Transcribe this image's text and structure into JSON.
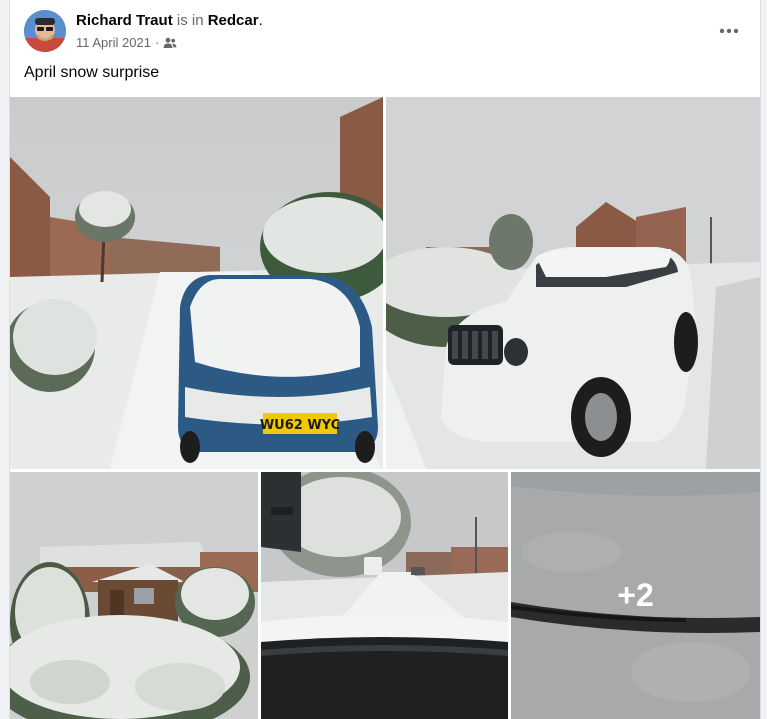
{
  "post": {
    "author": "Richard Traut",
    "location_connector": "is in",
    "location": "Redcar",
    "location_suffix": ".",
    "date": "11 April 2021",
    "date_separator": "·",
    "audience_icon": "friends-icon",
    "more_icon": "more-options-icon",
    "caption": "April snow surprise"
  },
  "photos": {
    "more_count_label": "+2",
    "items": [
      {
        "subject": "snow-covered blue hatchback",
        "plate": "WU62 WYC"
      },
      {
        "subject": "snow-covered white jeep"
      },
      {
        "subject": "snowy garden with shed"
      },
      {
        "subject": "snowy street through windscreen"
      },
      {
        "subject": "snow on windscreen wiper"
      }
    ]
  },
  "colors": {
    "text_primary": "#050505",
    "text_secondary": "#65676b",
    "card_bg": "#ffffff",
    "page_bg": "#f0f2f5"
  }
}
